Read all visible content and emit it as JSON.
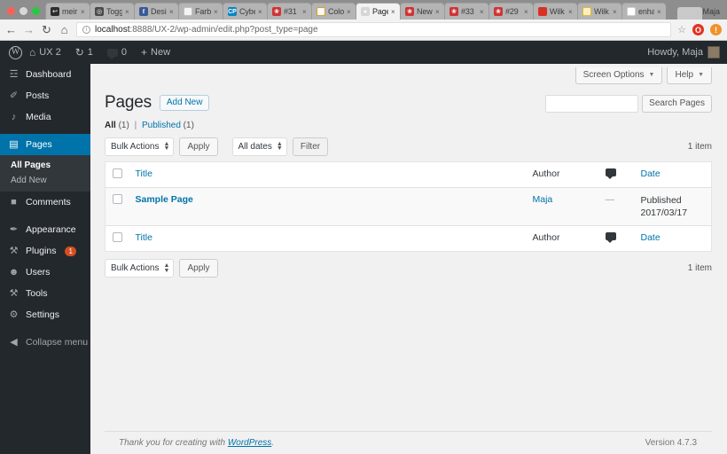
{
  "browser": {
    "tabs": [
      {
        "label": "meir",
        "favicon": "bookmark-icon",
        "favclass": "fav-meir",
        "glyph": "↩",
        "active": false
      },
      {
        "label": "Togg",
        "favicon": "toggl-icon",
        "favclass": "fav-togg",
        "glyph": "◎",
        "active": false
      },
      {
        "label": "Desi",
        "favicon": "facebook-icon",
        "favclass": "fav-fb",
        "glyph": "f",
        "active": false
      },
      {
        "label": "Farb",
        "favicon": "document-icon",
        "favclass": "fav-doc",
        "glyph": "",
        "active": false
      },
      {
        "label": "Cybe",
        "favicon": "cyber-icon",
        "favclass": "fav-cyb",
        "glyph": "CP",
        "active": false
      },
      {
        "label": "#31",
        "favicon": "wordpress-trac-icon",
        "favclass": "fav-wp",
        "glyph": "❀",
        "active": false
      },
      {
        "label": "Colo",
        "favicon": "evernote-icon",
        "favclass": "fav-e",
        "glyph": "e",
        "active": false
      },
      {
        "label": "Page",
        "favicon": "wordpress-icon",
        "favclass": "fav-page",
        "glyph": "●",
        "active": true
      },
      {
        "label": "New",
        "favicon": "wordpress-trac-icon",
        "favclass": "fav-wp",
        "glyph": "❀",
        "active": false
      },
      {
        "label": "#33",
        "favicon": "wordpress-trac-icon",
        "favclass": "fav-wp",
        "glyph": "❀",
        "active": false
      },
      {
        "label": "#29",
        "favicon": "wordpress-trac-icon",
        "favclass": "fav-wp",
        "glyph": "❀",
        "active": false
      },
      {
        "label": "Wilk",
        "favicon": "red-square-icon",
        "favclass": "fav-red",
        "glyph": "",
        "active": false
      },
      {
        "label": "Wilk",
        "favicon": "sun-icon",
        "favclass": "fav-sun",
        "glyph": "",
        "active": false
      },
      {
        "label": "enha",
        "favicon": "google-icon",
        "favclass": "fav-g",
        "glyph": "G",
        "active": false
      }
    ],
    "tab_close_glyph": "×",
    "profile_name": "Maja",
    "nav": {
      "back": "←",
      "forward": "→",
      "reload": "↻",
      "home": "⌂"
    },
    "url_host": "localhost",
    "url_rest": ":8888/UX-2/wp-admin/edit.php?post_type=page",
    "info_glyph": "ⓘ",
    "star_glyph": "☆",
    "extensions": [
      {
        "name": "opera-extension-icon",
        "glyph": "O",
        "class": "ext-opera"
      },
      {
        "name": "orange-extension-icon",
        "glyph": "!",
        "class": "ext-orange"
      }
    ]
  },
  "adminbar": {
    "logo_glyph": "W",
    "site_name": "UX 2",
    "site_icon": "⌂",
    "updates_count": "1",
    "updates_icon": "↻",
    "comments_count": "0",
    "comments_icon": "■",
    "new_label": "New",
    "new_icon": "+",
    "howdy": "Howdy, Maja"
  },
  "sidebar": {
    "items": [
      {
        "label": "Dashboard",
        "icon": "☲",
        "icon_name": "dashboard-icon",
        "current": false
      },
      {
        "label": "Posts",
        "icon": "✐",
        "icon_name": "pin-icon",
        "current": false
      },
      {
        "label": "Media",
        "icon": "♪",
        "icon_name": "media-icon",
        "current": false
      },
      {
        "label": "Pages",
        "icon": "▤",
        "icon_name": "page-icon",
        "current": true
      },
      {
        "label": "Comments",
        "icon": "■",
        "icon_name": "comment-icon",
        "current": false
      },
      {
        "label": "Appearance",
        "icon": "✒",
        "icon_name": "brush-icon",
        "current": false
      },
      {
        "label": "Plugins",
        "icon": "⚒",
        "icon_name": "plugin-icon",
        "current": false,
        "badge": "1"
      },
      {
        "label": "Users",
        "icon": "☻",
        "icon_name": "users-icon",
        "current": false
      },
      {
        "label": "Tools",
        "icon": "⚒",
        "icon_name": "tools-icon",
        "current": false
      },
      {
        "label": "Settings",
        "icon": "⚙",
        "icon_name": "settings-icon",
        "current": false
      }
    ],
    "submenu": [
      {
        "label": "All Pages",
        "current": true
      },
      {
        "label": "Add New",
        "current": false
      }
    ],
    "collapse": {
      "label": "Collapse menu",
      "icon": "◀"
    }
  },
  "screen_meta": {
    "screen_options": "Screen Options",
    "help": "Help",
    "caret": "▼"
  },
  "page": {
    "title": "Pages",
    "add_new": "Add New",
    "search_placeholder": "",
    "search_value": "",
    "search_button": "Search Pages",
    "views": {
      "all_label": "All",
      "all_count": "(1)",
      "separator": "|",
      "published_label": "Published",
      "published_count": "(1)"
    },
    "tablenav_top": {
      "bulk_actions": "Bulk Actions",
      "apply": "Apply",
      "all_dates": "All dates",
      "filter": "Filter",
      "item_count": "1 item"
    },
    "tablenav_bottom": {
      "bulk_actions": "Bulk Actions",
      "apply": "Apply",
      "item_count": "1 item"
    },
    "table": {
      "headers": {
        "title": "Title",
        "author": "Author",
        "comments": "comment-bubble-icon",
        "date": "Date"
      },
      "rows": [
        {
          "title": "Sample Page",
          "author": "Maja",
          "comments": "—",
          "date_status": "Published",
          "date_value": "2017/03/17"
        }
      ]
    }
  },
  "footer": {
    "thanks_before": "Thank you for creating with ",
    "thanks_link": "WordPress",
    "thanks_after": ".",
    "version": "Version 4.7.3"
  }
}
